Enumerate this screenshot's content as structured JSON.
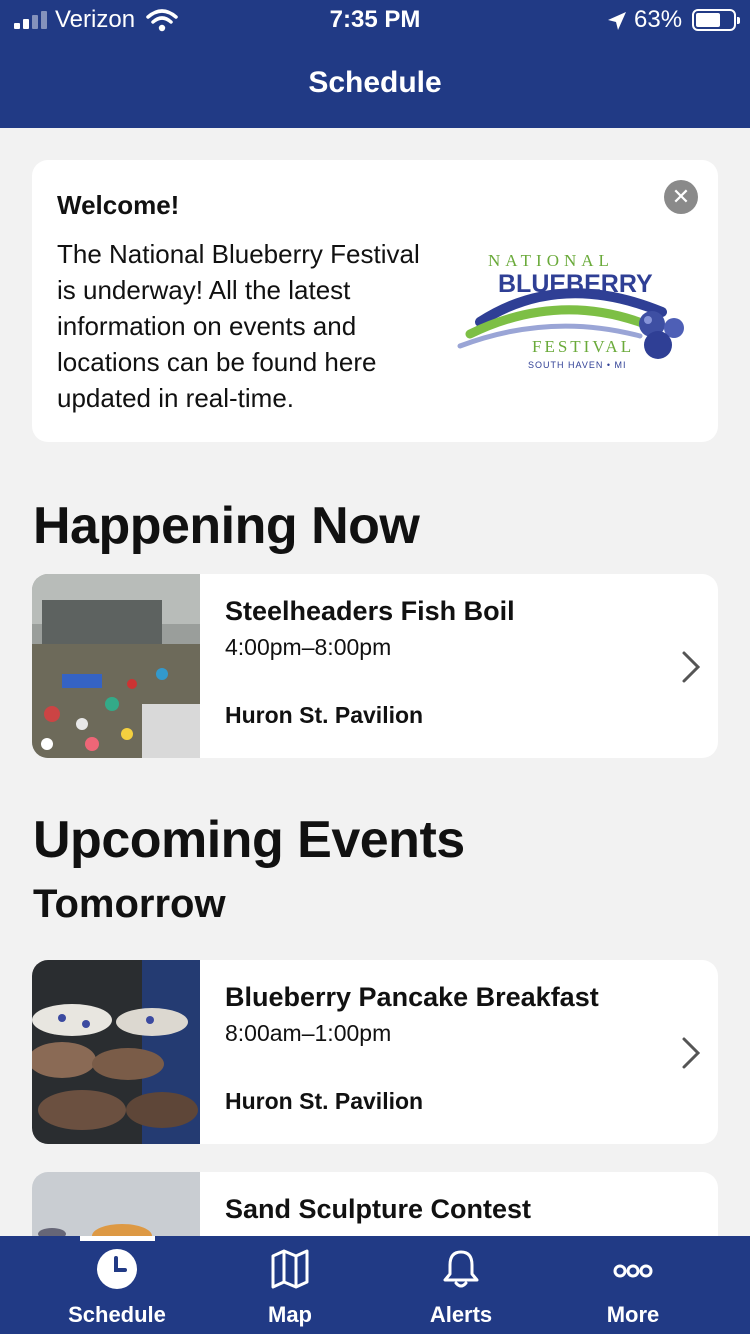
{
  "status_bar": {
    "carrier": "Verizon",
    "time": "7:35 PM",
    "battery": "63%"
  },
  "header": {
    "title": "Schedule"
  },
  "welcome": {
    "heading": "Welcome!",
    "body": "The National Blueberry Festival is underway! All the latest information on events and locations can be found here updated in real-time.",
    "logo": {
      "top_text": "NATIONAL",
      "main_text": "BLUEBERRY",
      "sub_text": "FESTIVAL",
      "location_text": "SOUTH HAVEN • MI"
    }
  },
  "sections": {
    "now_title": "Happening Now",
    "upcoming_title": "Upcoming Events",
    "day_title": "Tomorrow"
  },
  "now_events": [
    {
      "name": "Steelheaders Fish Boil",
      "time": "4:00pm–8:00pm",
      "place": "Huron St. Pavilion"
    }
  ],
  "upcoming_events": [
    {
      "name": "Blueberry Pancake Breakfast",
      "time": "8:00am–1:00pm",
      "place": "Huron St. Pavilion"
    },
    {
      "name": "Sand Sculpture Contest",
      "time": "",
      "place": ""
    }
  ],
  "tabs": [
    {
      "label": "Schedule",
      "icon": "clock-icon",
      "active": true
    },
    {
      "label": "Map",
      "icon": "map-icon",
      "active": false
    },
    {
      "label": "Alerts",
      "icon": "bell-icon",
      "active": false
    },
    {
      "label": "More",
      "icon": "more-icon",
      "active": false
    }
  ],
  "colors": {
    "brand": "#213a85",
    "background": "#f2f2f2",
    "card": "#ffffff"
  }
}
